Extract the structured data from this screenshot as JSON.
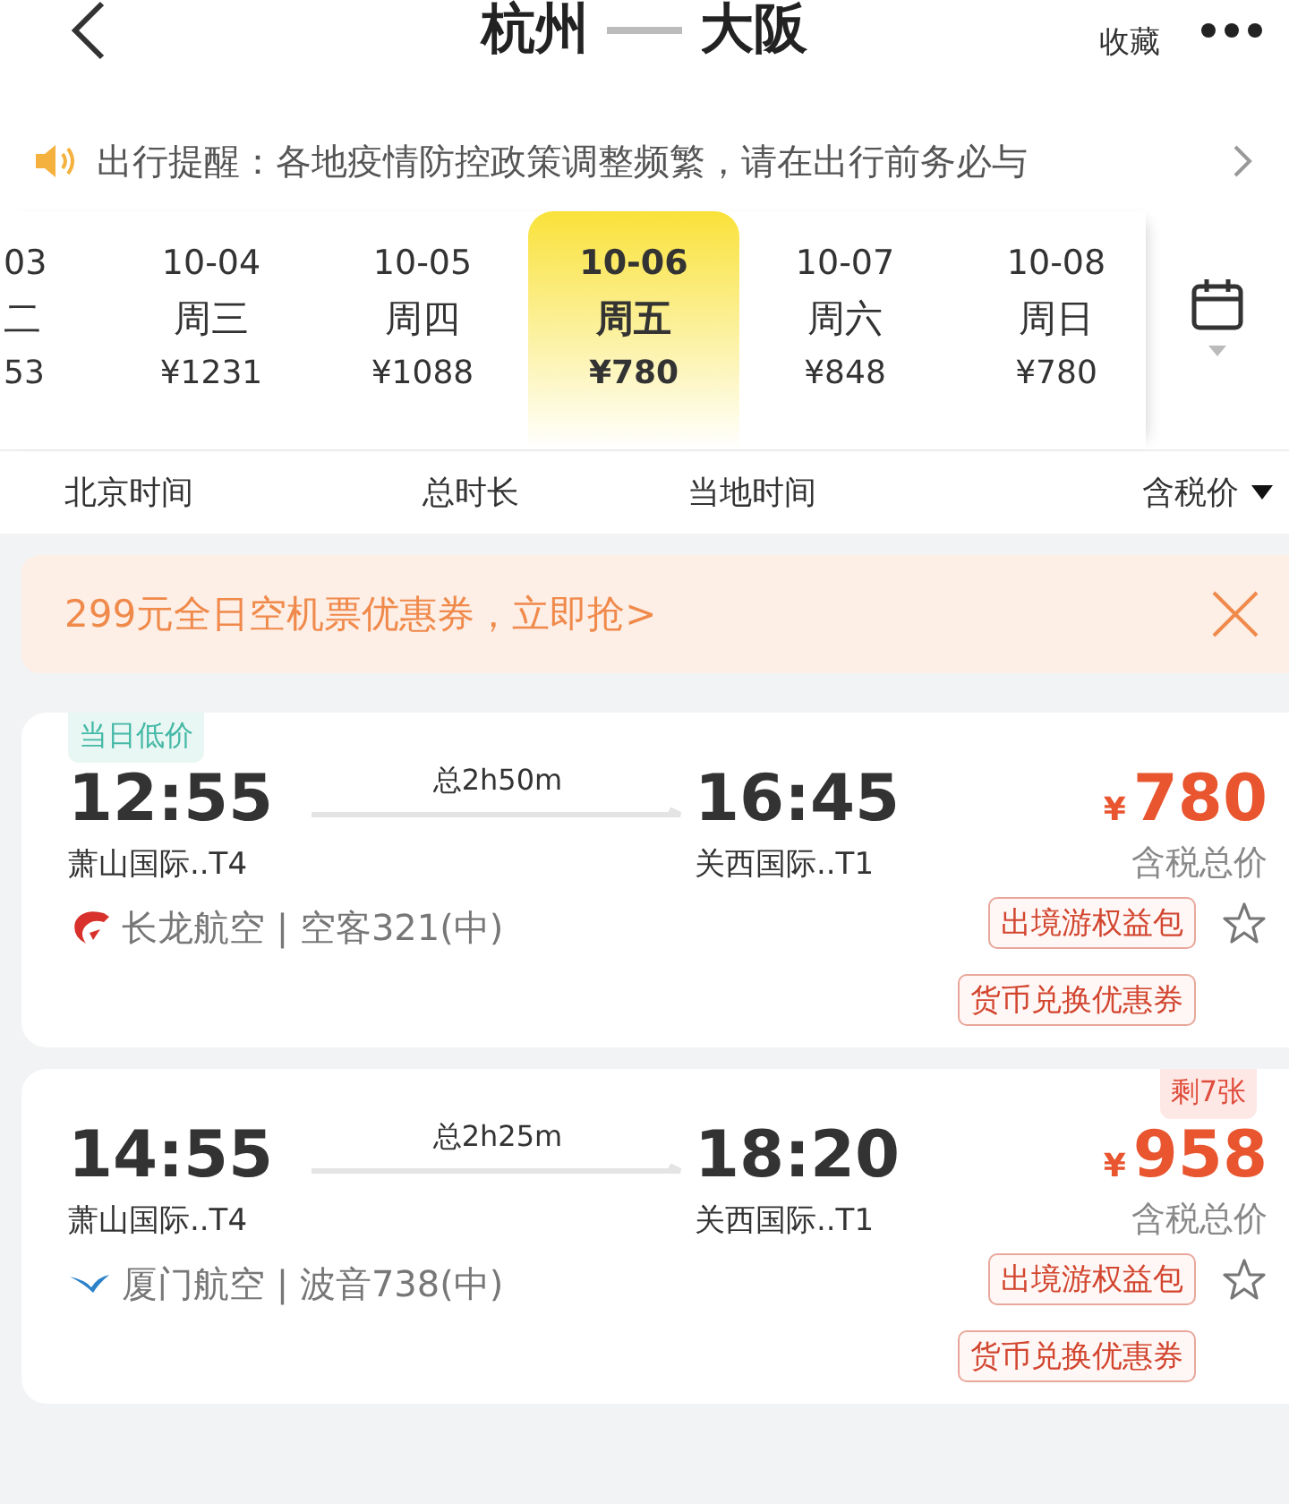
{
  "header": {
    "from": "杭州",
    "to": "大阪",
    "favorite": "收藏"
  },
  "notice": {
    "text": "出行提醒：各地疫情防控政策调整频繁，请在出行前务必与"
  },
  "dates": [
    {
      "date": "03",
      "weekday": "二",
      "price": "53",
      "selected": false
    },
    {
      "date": "10-04",
      "weekday": "周三",
      "price": "¥1231",
      "selected": false
    },
    {
      "date": "10-05",
      "weekday": "周四",
      "price": "¥1088",
      "selected": false
    },
    {
      "date": "10-06",
      "weekday": "周五",
      "price": "¥780",
      "selected": true
    },
    {
      "date": "10-07",
      "weekday": "周六",
      "price": "¥848",
      "selected": false
    },
    {
      "date": "10-08",
      "weekday": "周日",
      "price": "¥780",
      "selected": false
    }
  ],
  "sort_bar": [
    "北京时间",
    "总时长",
    "当地时间",
    "含税价"
  ],
  "coupon_banner": {
    "text": "299元全日空机票优惠券，立即抢>"
  },
  "flights": [
    {
      "badge": {
        "kind": "low",
        "text": "当日低价"
      },
      "depart": "12:55",
      "duration": "总2h50m",
      "arrive": "16:45",
      "from_airport": "萧山国际..T4",
      "to_airport": "关西国际..T1",
      "currency": "¥",
      "price": "780",
      "price_note": "含税总价",
      "airline": "长龙航空 | 空客321(中)",
      "tags": [
        "出境游权益包",
        "货币兑换优惠券"
      ]
    },
    {
      "badge": {
        "kind": "left",
        "text": "剩7张"
      },
      "depart": "14:55",
      "duration": "总2h25m",
      "arrive": "18:20",
      "from_airport": "萧山国际..T4",
      "to_airport": "关西国际..T1",
      "currency": "¥",
      "price": "958",
      "price_note": "含税总价",
      "airline": "厦门航空 | 波音738(中)",
      "tags": [
        "出境游权益包",
        "货币兑换优惠券"
      ]
    }
  ]
}
